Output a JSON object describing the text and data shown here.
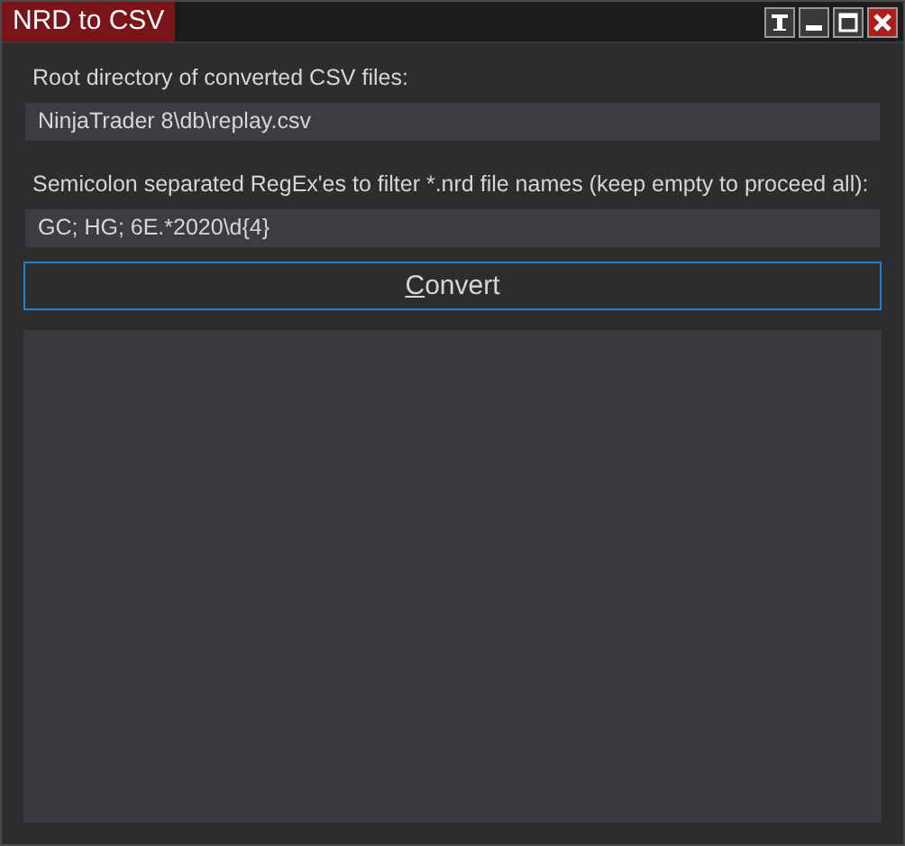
{
  "window": {
    "title": "NRD to CSV"
  },
  "fields": [
    {
      "label": "Root directory of converted CSV files:",
      "value": "NinjaTrader 8\\db\\replay.csv"
    },
    {
      "label": "Semicolon separated RegEx'es to filter *.nrd file names (keep empty to proceed all):",
      "value": "GC; HG; 6E.*2020\\d{4}"
    }
  ],
  "convert_button": {
    "label_parts": [
      {
        "text": "C",
        "underlined": true
      },
      {
        "text": "onvert",
        "underlined": false
      }
    ],
    "focused": true
  }
}
